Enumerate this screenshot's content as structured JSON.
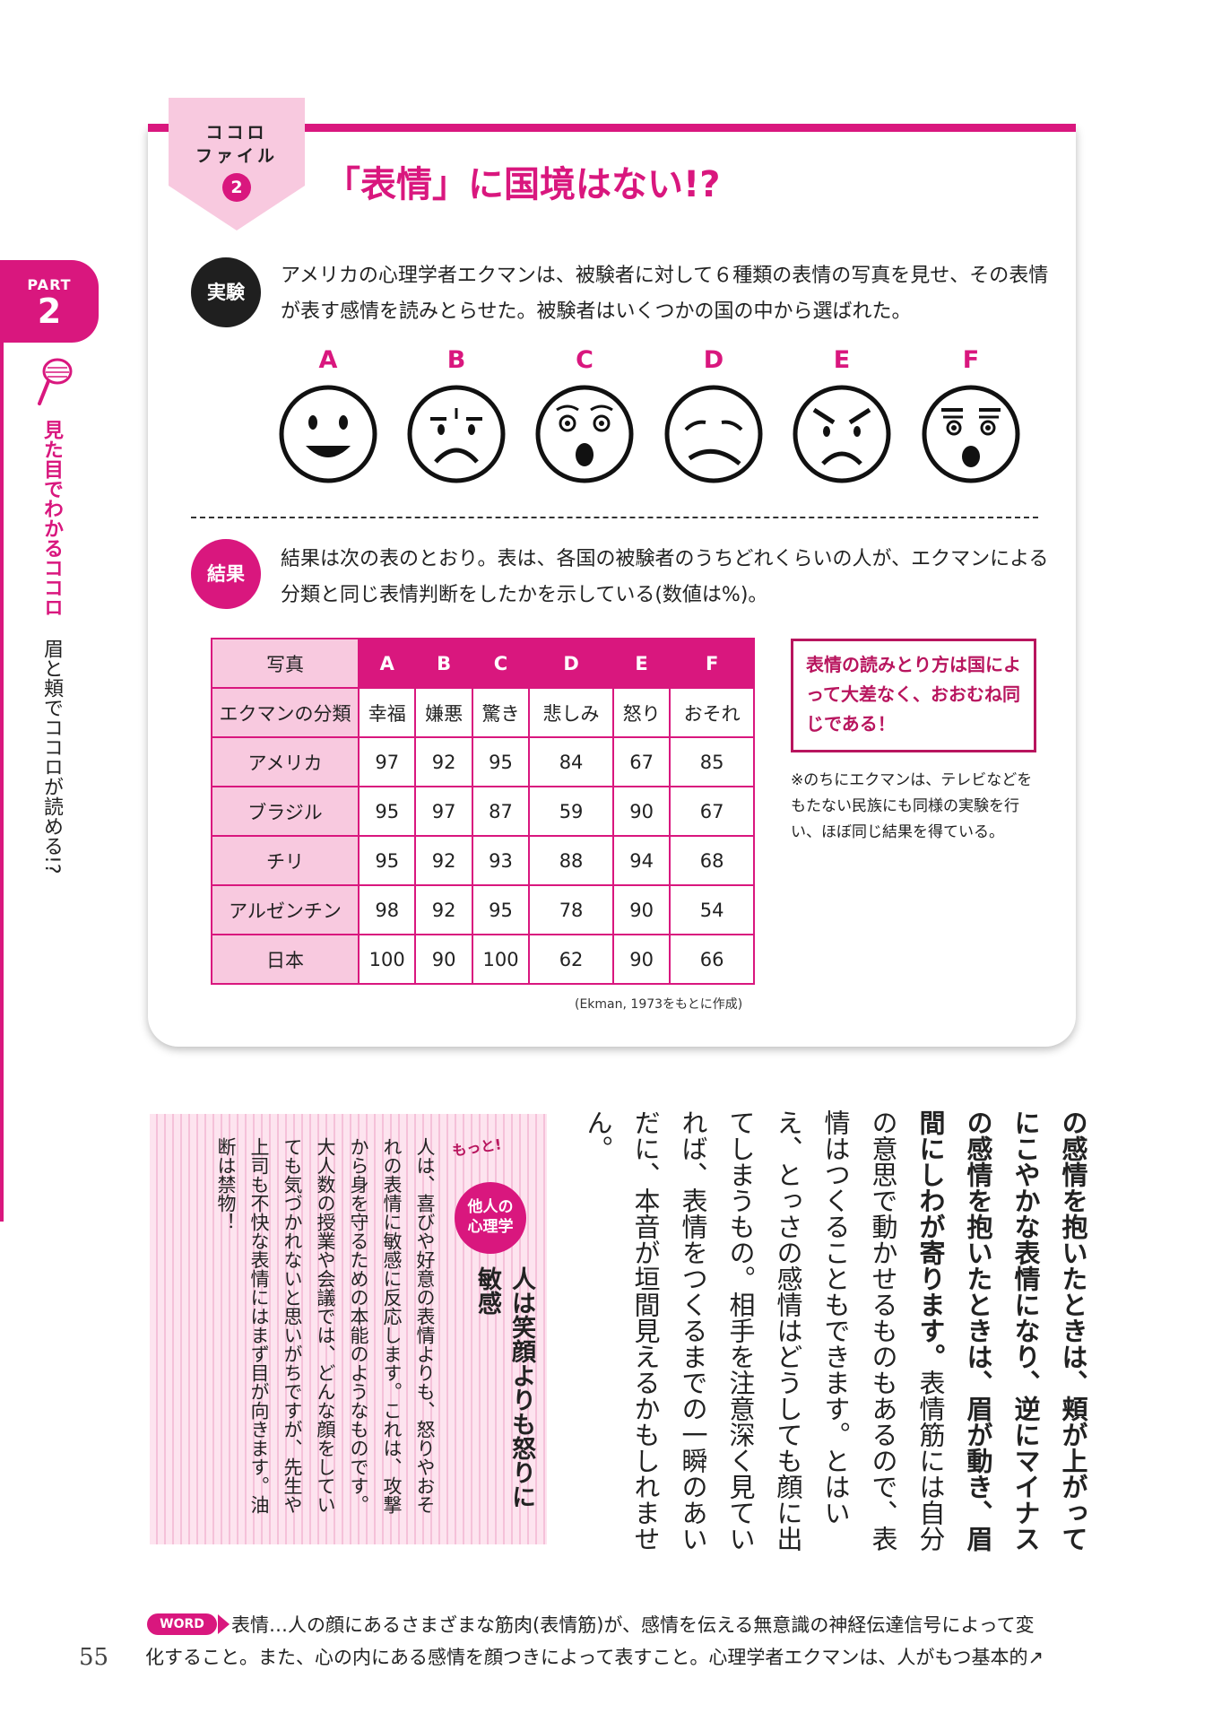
{
  "sidebar": {
    "part_label": "PART",
    "part_number": "2",
    "title_main": "見た目でわかるココロ",
    "title_sub": "眉と頬でココロが読める!?"
  },
  "card": {
    "badge_line1": "ココロ",
    "badge_line2": "ファイル",
    "badge_number": "2",
    "title": "「表情」に国境はない!?",
    "experiment_tag": "実験",
    "experiment_text": "アメリカの心理学者エクマンは、被験者に対して６種類の表情の写真を見せ、その表情が表す感情を読みとらせた。被験者はいくつかの国の中から選ばれた。",
    "faces": [
      "A",
      "B",
      "C",
      "D",
      "E",
      "F"
    ],
    "result_tag": "結果",
    "result_text": "結果は次の表のとおり。表は、各国の被験者のうちどれくらいの人が、エクマンによる分類と同じ表情判断をしたかを示している(数値は%)。",
    "table": {
      "photo_header": "写真",
      "class_header": "エクマンの分類",
      "columns": [
        "A",
        "B",
        "C",
        "D",
        "E",
        "F"
      ],
      "classes": [
        "幸福",
        "嫌悪",
        "驚き",
        "悲しみ",
        "怒り",
        "おそれ"
      ],
      "rows": [
        {
          "country": "アメリカ",
          "values": [
            "97",
            "92",
            "95",
            "84",
            "67",
            "85"
          ]
        },
        {
          "country": "ブラジル",
          "values": [
            "95",
            "97",
            "87",
            "59",
            "90",
            "67"
          ]
        },
        {
          "country": "チリ",
          "values": [
            "95",
            "92",
            "93",
            "88",
            "94",
            "68"
          ]
        },
        {
          "country": "アルゼンチン",
          "values": [
            "98",
            "92",
            "95",
            "78",
            "90",
            "54"
          ]
        },
        {
          "country": "日本",
          "values": [
            "100",
            "90",
            "100",
            "62",
            "90",
            "66"
          ]
        }
      ],
      "source": "(Ekman, 1973をもとに作成)"
    },
    "summary": "表情の読みとり方は国によって大差なく、おおむね同じである！",
    "note": "※のちにエクマンは、テレビなどをもたない民族にも同様の実験を行い、ほぼ同じ結果を得ている。"
  },
  "main": {
    "emph_text": "の感情を抱いたときは、頬が上がってにこやかな表情になり、逆にマイナスの感情を抱いたときは、眉が動き、眉間にしわが寄ります。",
    "body_text": "表情筋には自分の意思で動かせるものもあるので、表情はつくることもできます。とはいえ、とっさの感情はどうしても顔に出てしまうもの。相手を注意深く見ていれば、表情をつくるまでの一瞬のあいだに、本音が垣間見えるかもしれません。"
  },
  "more": {
    "label": "もっと!",
    "circle_line1": "他人の",
    "circle_line2": "心理学",
    "heading": "人は笑顔よりも怒りに敏感",
    "text": "人は、喜びや好意の表情よりも、怒りやおそれの表情に敏感に反応します。これは、攻撃から身を守るための本能のようなものです。大人数の授業や会議では、どんな顔をしていても気づかれないと思いがちですが、先生や上司も不快な表情にはまず目が向きます。油断は禁物！"
  },
  "footer": {
    "word_label": "WORD",
    "line1": "表情…人の顔にあるさまざまな筋肉(表情筋)が、感情を伝える無意識の神経伝達信号によって変",
    "line2": "化すること。また、心の内にある感情を顔つきによって表すこと。心理学者エクマンは、人がもつ基本的↗",
    "page_number": "55"
  },
  "colors": {
    "accent": "#d9177e",
    "accent_light": "#f8c9df",
    "accent_dark": "#b8155e",
    "text": "#222222"
  }
}
